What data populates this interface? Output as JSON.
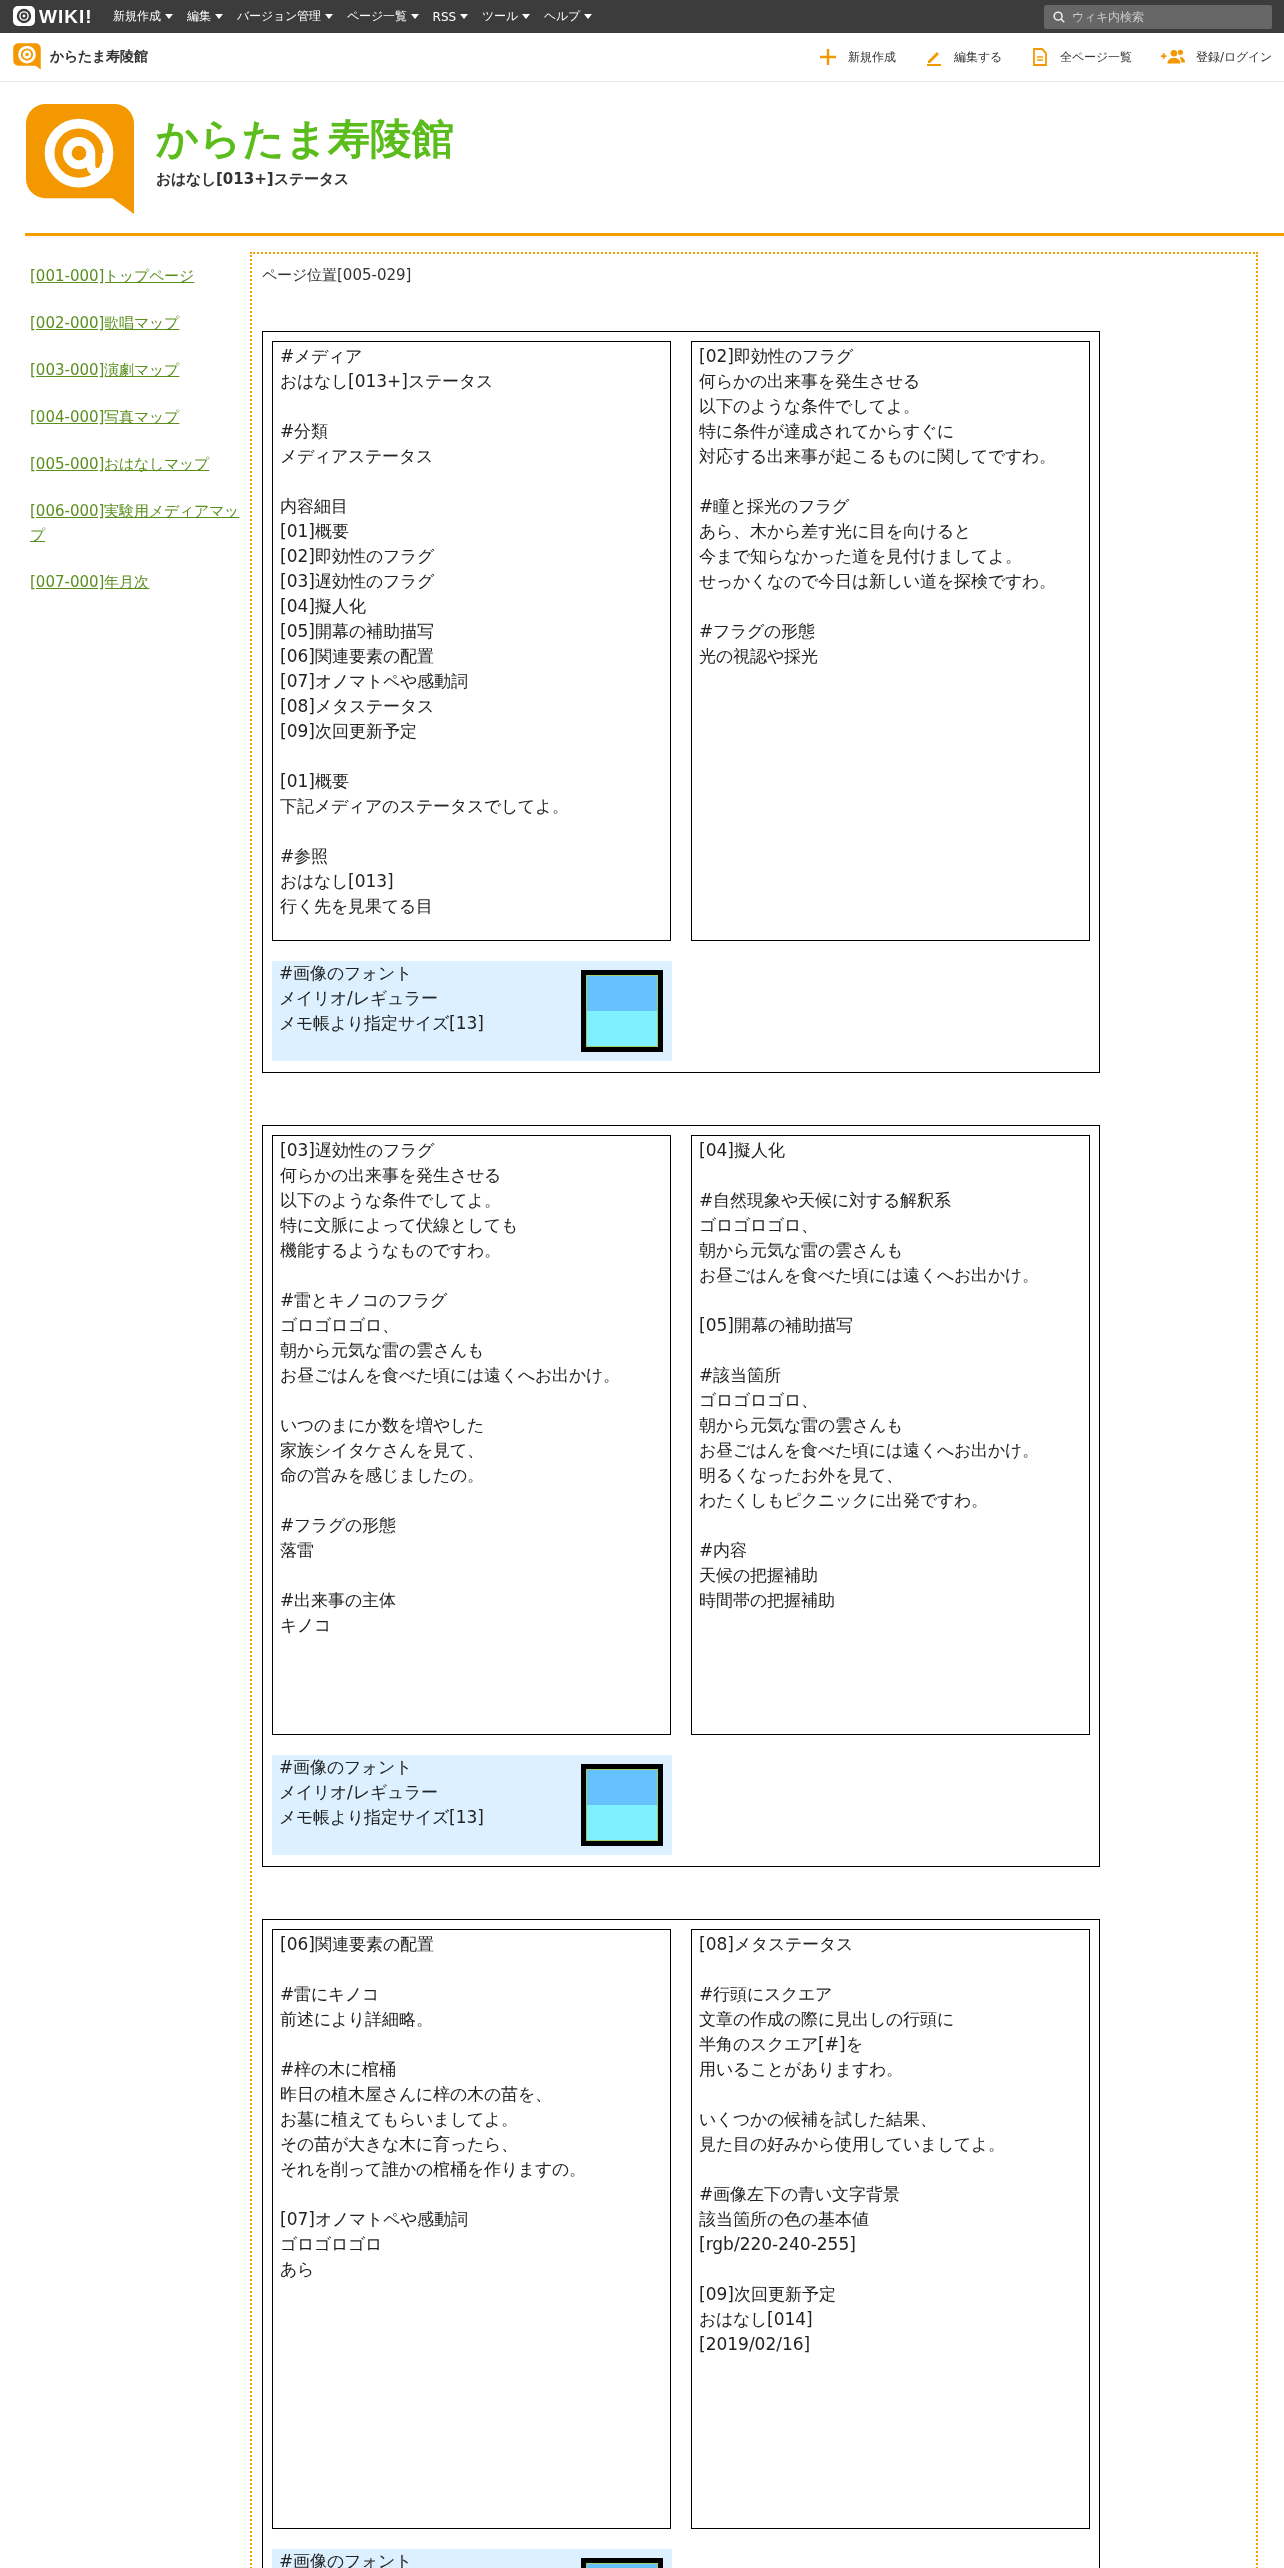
{
  "top_bar": {
    "logo_text": "WIKI!",
    "menu": [
      "新規作成",
      "編集",
      "バージョン管理",
      "ページ一覧",
      "RSS",
      "ツール",
      "ヘルプ"
    ],
    "search": {
      "placeholder": "ウィキ内検索"
    }
  },
  "site_bar": {
    "site_name": "からたま寿陵館",
    "actions": [
      {
        "kind": "plus",
        "label": "新規作成"
      },
      {
        "kind": "pencil",
        "label": "編集する"
      },
      {
        "kind": "document",
        "label": "全ページ一覧"
      },
      {
        "kind": "user",
        "label": "登録/ログイン"
      }
    ]
  },
  "header": {
    "title": "からたま寿陵館",
    "subtitle": "おはなし[013+]ステータス"
  },
  "sidebar": {
    "items": [
      "[001-000]トップページ",
      "[002-000]歌唱マップ",
      "[003-000]演劇マップ",
      "[004-000]写真マップ",
      "[005-000]おはなしマップ",
      "[006-000]実験用メディアマップ",
      "[007-000]年月次"
    ]
  },
  "page_position": "ページ位置[005-029]",
  "sections": [
    {
      "left": [
        [
          "#メディア",
          "おはなし[013+]ステータス"
        ],
        [
          "#分類",
          "メディアステータス"
        ],
        [
          "内容細目",
          "[01]概要",
          "[02]即効性のフラグ",
          "[03]遅効性のフラグ",
          "[04]擬人化",
          "[05]開幕の補助描写",
          "[06]関連要素の配置",
          "[07]オノマトペや感動詞",
          "[08]メタステータス",
          "[09]次回更新予定"
        ],
        [
          "[01]概要",
          "下記メディアのステータスでしてよ。"
        ],
        [
          "#参照",
          "おはなし[013]",
          "行く先を見果てる目"
        ]
      ],
      "right": [
        [
          "[02]即効性のフラグ",
          "何らかの出来事を発生させる",
          "以下のような条件でしてよ。",
          "特に条件が達成されてからすぐに",
          "対応する出来事が起こるものに関してですわ。"
        ],
        [
          "#瞳と採光のフラグ",
          "あら、木から差す光に目を向けると",
          "今まで知らなかった道を見付けましてよ。",
          "せっかくなので今日は新しい道を探検ですわ。"
        ],
        [
          "#フラグの形態",
          "光の視認や採光"
        ]
      ],
      "caption": [
        "#画像のフォント",
        "メイリオ/レギュラー",
        "メモ帳より指定サイズ[13]"
      ]
    },
    {
      "left": [
        [
          "[03]遅効性のフラグ",
          "何らかの出来事を発生させる",
          "以下のような条件でしてよ。",
          "特に文脈によって伏線としても",
          "機能するようなものですわ。"
        ],
        [
          "#雷とキノコのフラグ",
          "ゴロゴロゴロ、",
          "朝から元気な雷の雲さんも",
          "お昼ごはんを食べた頃には遠くへお出かけ。"
        ],
        [
          "いつのまにか数を増やした",
          "家族シイタケさんを見て、",
          "命の営みを感じましたの。"
        ],
        [
          "#フラグの形態",
          "落雷"
        ],
        [
          "#出来事の主体",
          "キノコ"
        ]
      ],
      "right": [
        [
          "[04]擬人化"
        ],
        [
          "#自然現象や天候に対する解釈系",
          "ゴロゴロゴロ、",
          "朝から元気な雷の雲さんも",
          "お昼ごはんを食べた頃には遠くへお出かけ。"
        ],
        [
          "[05]開幕の補助描写"
        ],
        [
          "#該当箇所",
          "ゴロゴロゴロ、",
          "朝から元気な雷の雲さんも",
          "お昼ごはんを食べた頃には遠くへお出かけ。",
          "明るくなったお外を見て、",
          "わたくしもピクニックに出発ですわ。"
        ],
        [
          "#内容",
          "天候の把握補助",
          "時間帯の把握補助"
        ]
      ],
      "caption": [
        "#画像のフォント",
        "メイリオ/レギュラー",
        "メモ帳より指定サイズ[13]"
      ]
    },
    {
      "left": [
        [
          "[06]関連要素の配置"
        ],
        [
          "#雷にキノコ",
          "前述により詳細略。"
        ],
        [
          "#梓の木に棺桶",
          "昨日の植木屋さんに梓の木の苗を、",
          "お墓に植えてもらいましてよ。",
          "その苗が大きな木に育ったら、",
          "それを削って誰かの棺桶を作りますの。"
        ],
        [
          "[07]オノマトペや感動詞",
          "ゴロゴロゴロ",
          "あら"
        ]
      ],
      "right": [
        [
          "[08]メタステータス"
        ],
        [
          "#行頭にスクエア",
          "文章の作成の際に見出しの行頭に",
          "半角のスクエア[#]を",
          "用いることがありますわ。"
        ],
        [
          "いくつかの候補を試した結果、",
          "見た目の好みから使用していましてよ。"
        ],
        [
          "#画像左下の青い文字背景",
          "該当箇所の色の基本値",
          "[rgb/220-240-255]"
        ],
        [
          "[09]次回更新予定",
          "おはなし[014]",
          "[2019/02/16]"
        ]
      ],
      "caption": [
        "#画像のフォント"
      ]
    }
  ]
}
